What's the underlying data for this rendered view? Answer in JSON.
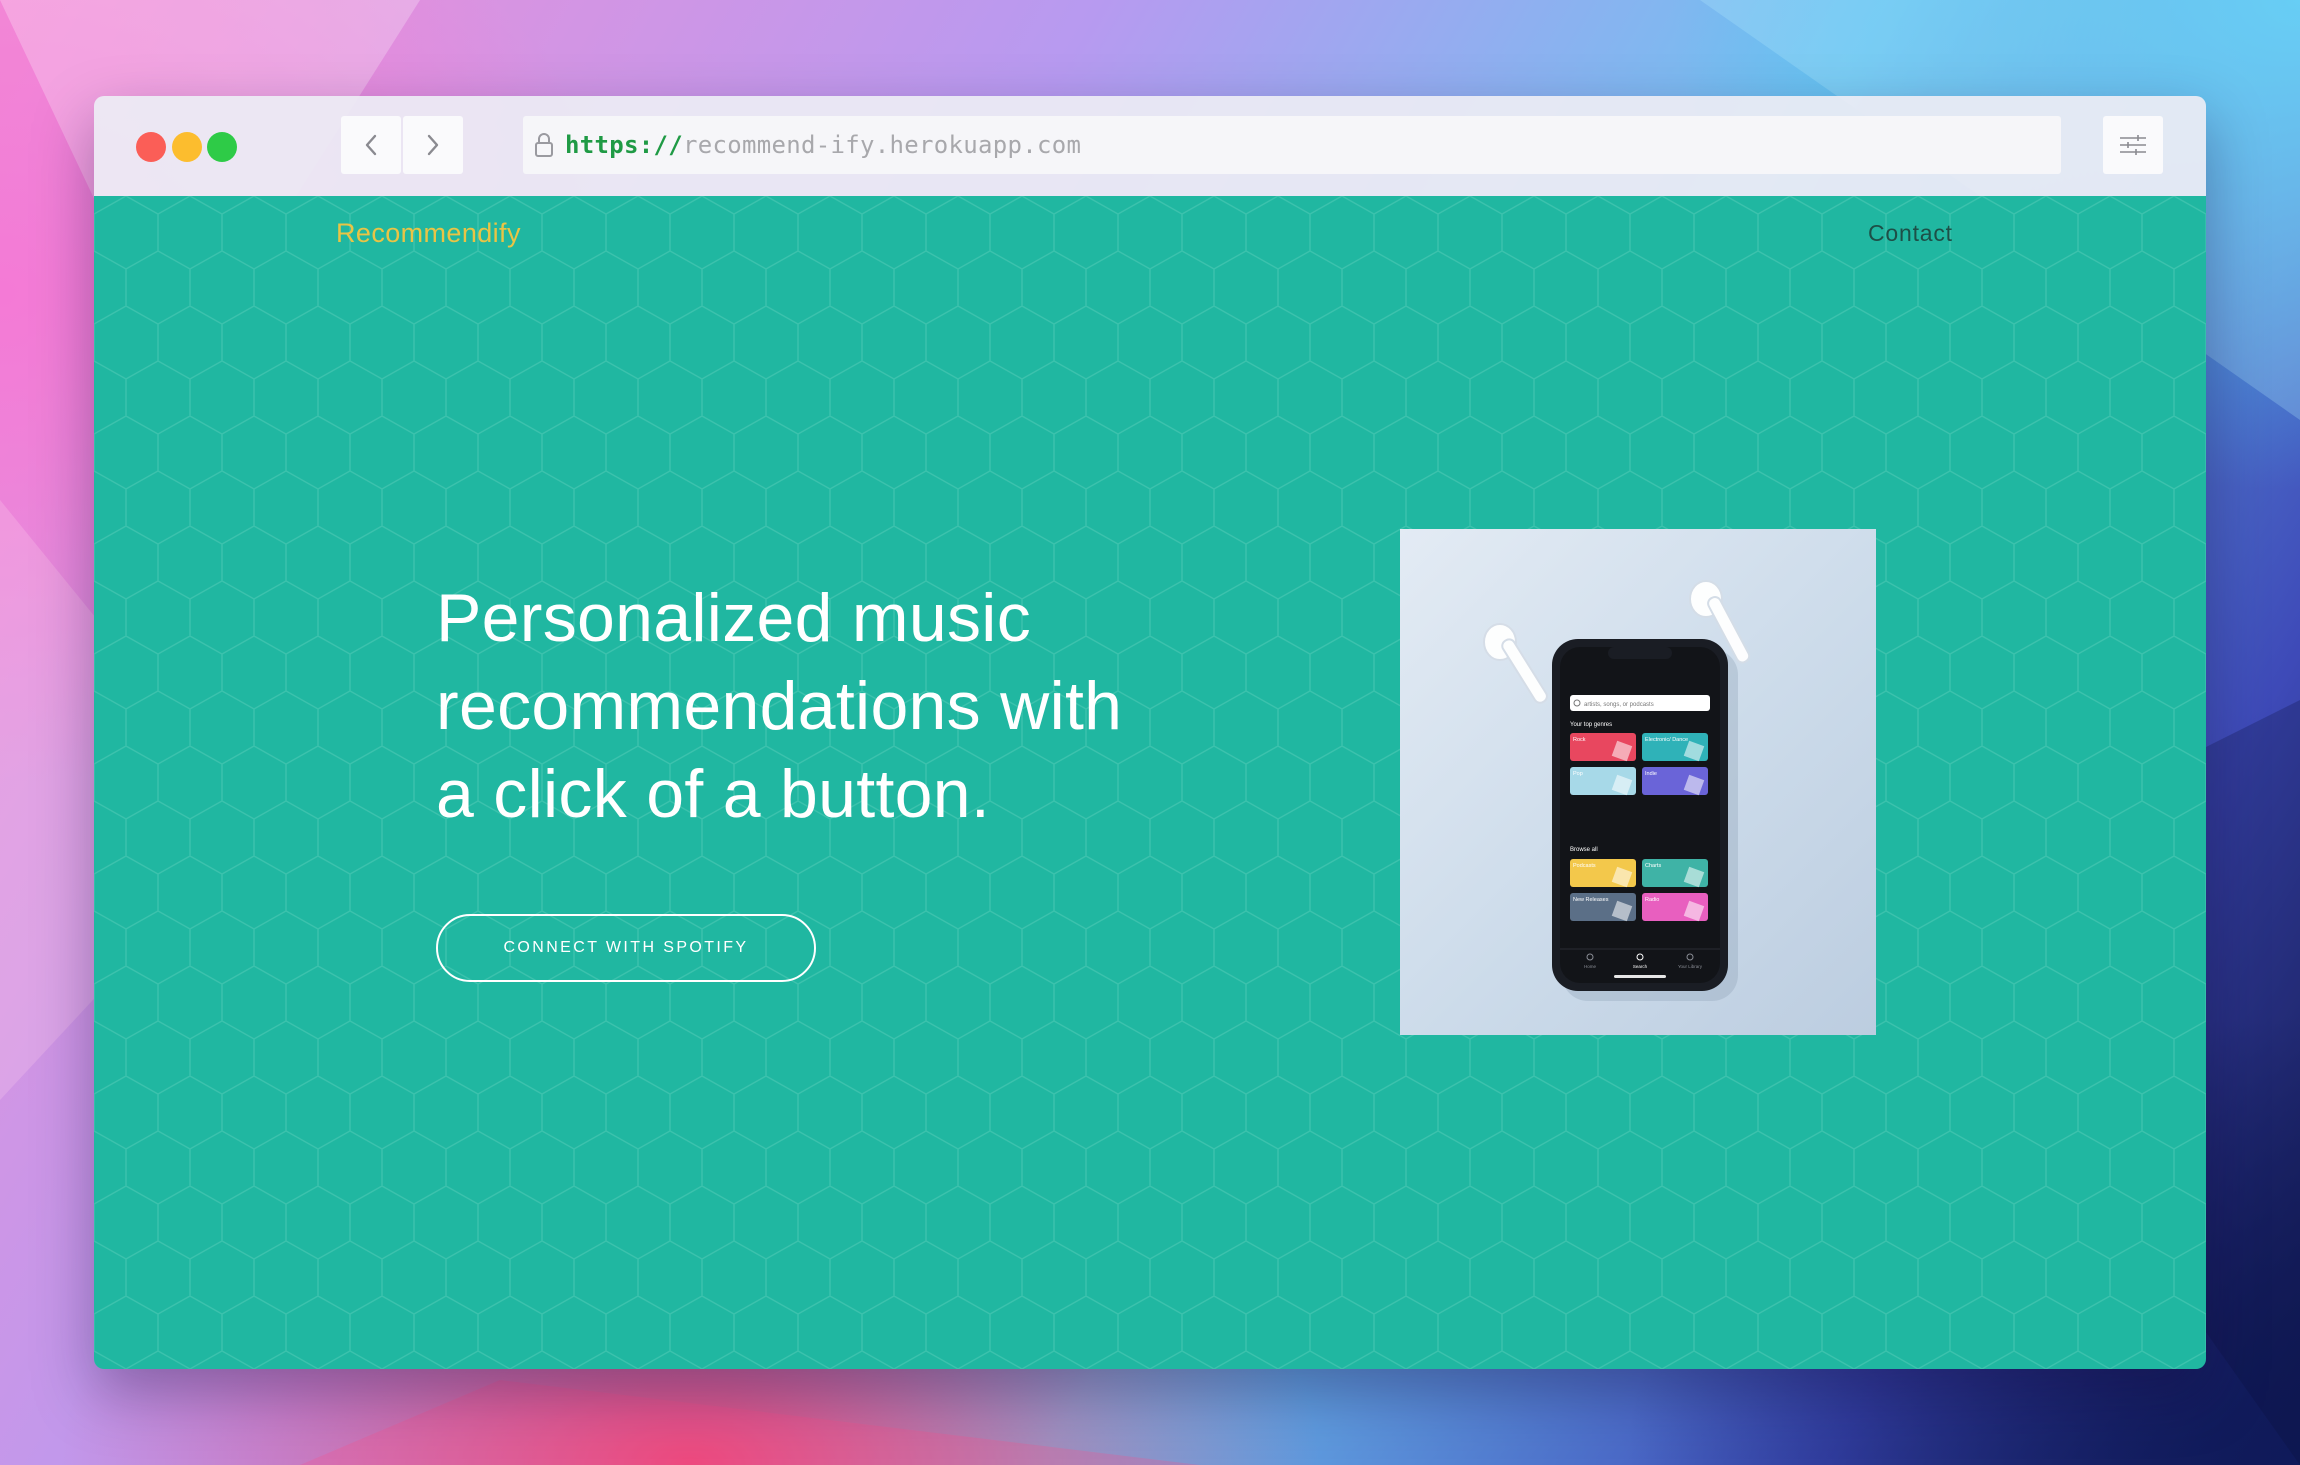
{
  "browser": {
    "url_scheme": "https://",
    "url_host": "recommend-ify.herokuapp.com"
  },
  "site": {
    "brand": "Recommendify",
    "nav": {
      "contact": "Contact"
    },
    "hero": {
      "headline_lines": [
        "Personalized music",
        "recommendations with",
        "a click of a button."
      ],
      "cta": "CONNECT WITH SPOTIFY"
    }
  },
  "phone_screen": {
    "search_placeholder": "artists, songs, or podcasts",
    "section_top": "Your top genres",
    "top_genres": [
      "Rock",
      "Electronic/ Dance",
      "Pop",
      "Indie"
    ],
    "section_browse": "Browse all",
    "browse": [
      "Podcasts",
      "Charts",
      "New Releases",
      "Radio"
    ],
    "tabs": [
      "Home",
      "Search",
      "Your Library"
    ]
  },
  "colors": {
    "page_bg": "#20b7a1",
    "brand": "#e9c445",
    "contact": "#1d4f47",
    "tile_colors": [
      "#e8475f",
      "#2fb2b8",
      "#a7d9e8",
      "#6a64d8",
      "#f3c84b",
      "#3fb3a6",
      "#5b6f87",
      "#e85fbf"
    ]
  },
  "icons": [
    "back-arrow-icon",
    "forward-arrow-icon",
    "lock-icon",
    "sliders-icon"
  ]
}
